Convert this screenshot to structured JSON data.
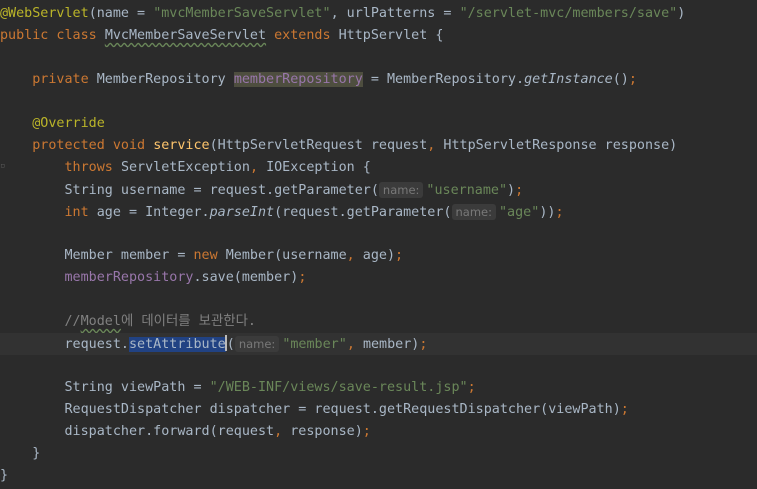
{
  "editor": {
    "theme_colors": {
      "background": "#2b2b2b",
      "keyword": "#cc7832",
      "string": "#6a8759",
      "annotation": "#bbb529",
      "method_decl": "#ffc66d",
      "field": "#9876aa",
      "comment": "#808080"
    },
    "lines": [
      [
        {
          "t": "@WebServlet",
          "c": "ann"
        },
        {
          "t": "(name = ",
          "c": "plain"
        },
        {
          "t": "\"mvcMemberSaveServlet\"",
          "c": "str"
        },
        {
          "t": ", urlPatterns = ",
          "c": "plain"
        },
        {
          "t": "\"/servlet-mvc/members/save\"",
          "c": "str"
        },
        {
          "t": ")",
          "c": "plain"
        }
      ],
      [
        {
          "t": "public class ",
          "c": "kw"
        },
        {
          "t": "MvcMemberSaveServlet",
          "c": "plain",
          "u": "wavy"
        },
        {
          "t": " extends ",
          "c": "kw"
        },
        {
          "t": "HttpServlet {",
          "c": "plain"
        }
      ],
      [],
      [
        {
          "t": "    private ",
          "c": "kw"
        },
        {
          "t": "MemberRepository ",
          "c": "plain"
        },
        {
          "t": "memberRepository",
          "c": "field",
          "hl": "grey"
        },
        {
          "t": " = MemberRepository.",
          "c": "plain"
        },
        {
          "t": "getInstance",
          "c": "static"
        },
        {
          "t": "()",
          "c": "plain"
        },
        {
          "t": ";",
          "c": "kw"
        }
      ],
      [],
      [
        {
          "t": "    @Override",
          "c": "ann"
        }
      ],
      [
        {
          "t": "    protected void ",
          "c": "kw"
        },
        {
          "t": "service",
          "c": "fn"
        },
        {
          "t": "(HttpServletRequest request",
          "c": "plain"
        },
        {
          "t": ", ",
          "c": "kw"
        },
        {
          "t": "HttpServletResponse response)",
          "c": "plain"
        }
      ],
      [
        {
          "t": "        throws ",
          "c": "kw"
        },
        {
          "t": "ServletException",
          "c": "plain"
        },
        {
          "t": ", ",
          "c": "kw"
        },
        {
          "t": "IOException {",
          "c": "plain"
        }
      ],
      [
        {
          "t": "        String username = request.getParameter(",
          "c": "plain"
        },
        {
          "t": "name:",
          "c": "hint"
        },
        {
          "t": "\"username\"",
          "c": "str"
        },
        {
          "t": ")",
          "c": "plain"
        },
        {
          "t": ";",
          "c": "kw"
        }
      ],
      [
        {
          "t": "        int ",
          "c": "kw"
        },
        {
          "t": "age = Integer.",
          "c": "plain"
        },
        {
          "t": "parseInt",
          "c": "static"
        },
        {
          "t": "(request.getParameter(",
          "c": "plain"
        },
        {
          "t": "name:",
          "c": "hint"
        },
        {
          "t": "\"age\"",
          "c": "str"
        },
        {
          "t": "))",
          "c": "plain"
        },
        {
          "t": ";",
          "c": "kw"
        }
      ],
      [],
      [
        {
          "t": "        Member member = ",
          "c": "plain"
        },
        {
          "t": "new ",
          "c": "kw"
        },
        {
          "t": "Member(username",
          "c": "plain"
        },
        {
          "t": ", ",
          "c": "kw"
        },
        {
          "t": "age)",
          "c": "plain"
        },
        {
          "t": ";",
          "c": "kw"
        }
      ],
      [
        {
          "t": "        ",
          "c": "plain"
        },
        {
          "t": "memberRepository",
          "c": "field"
        },
        {
          "t": ".save(member)",
          "c": "plain"
        },
        {
          "t": ";",
          "c": "kw"
        }
      ],
      [],
      [
        {
          "t": "        //",
          "c": "comment"
        },
        {
          "t": "Model",
          "c": "comment",
          "u": "wavy"
        },
        {
          "t": "에 데이터를 보관한다.",
          "c": "comment"
        }
      ],
      [
        {
          "t": "        request.",
          "c": "plain"
        },
        {
          "t": "setAttribute",
          "c": "plain",
          "hl": "blue"
        },
        {
          "t": "(",
          "c": "plain",
          "caret": true
        },
        {
          "t": "name:",
          "c": "hint"
        },
        {
          "t": "\"member\"",
          "c": "str"
        },
        {
          "t": ", ",
          "c": "kw"
        },
        {
          "t": "member)",
          "c": "plain"
        },
        {
          "t": ";",
          "c": "kw"
        }
      ],
      [],
      [
        {
          "t": "        String viewPath = ",
          "c": "plain"
        },
        {
          "t": "\"/WEB-INF/views/save-result.jsp\"",
          "c": "str"
        },
        {
          "t": ";",
          "c": "kw"
        }
      ],
      [
        {
          "t": "        RequestDispatcher dispatcher = request.getRequestDispatcher(viewPath)",
          "c": "plain"
        },
        {
          "t": ";",
          "c": "kw"
        }
      ],
      [
        {
          "t": "        dispatcher.forward(request",
          "c": "plain"
        },
        {
          "t": ", ",
          "c": "kw"
        },
        {
          "t": "response)",
          "c": "plain"
        },
        {
          "t": ";",
          "c": "kw"
        }
      ],
      [
        {
          "t": "    }",
          "c": "plain"
        }
      ],
      [
        {
          "t": "}",
          "c": "plain"
        }
      ]
    ]
  }
}
